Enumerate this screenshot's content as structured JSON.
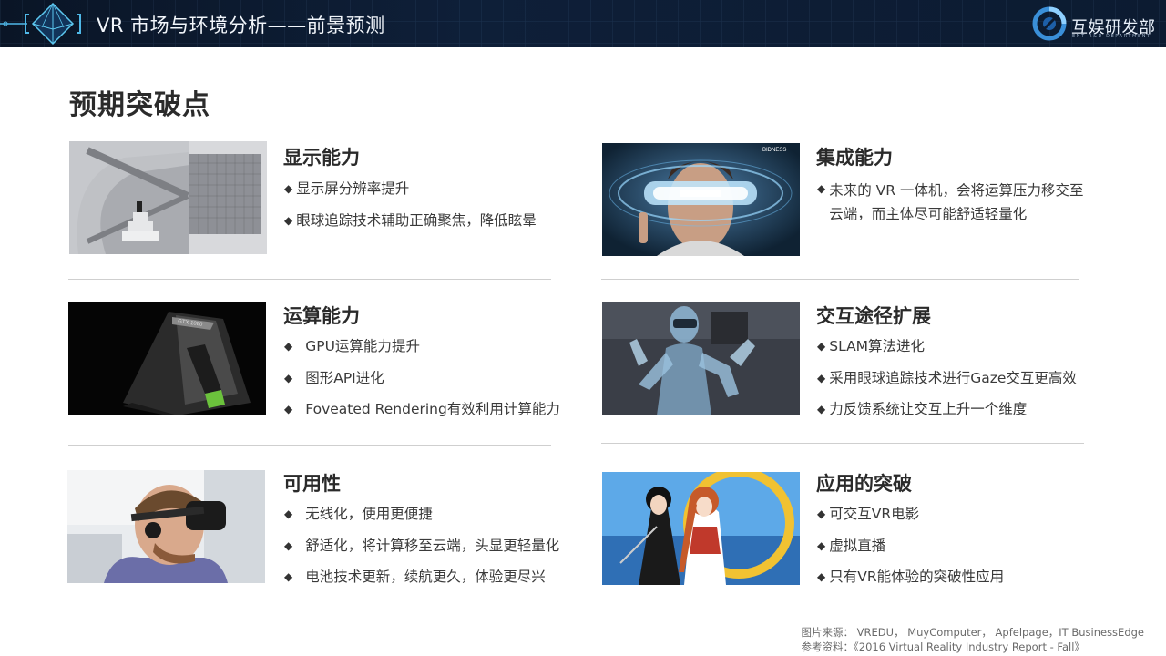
{
  "header": {
    "title": "VR 市场与环境分析——前景预测",
    "brand_name": "互娱研发部",
    "brand_sub": "ENT R&D DEPARTMENT"
  },
  "page_title": "预期突破点",
  "sections": [
    {
      "heading": "显示能力",
      "bullets": [
        "显示屏分辨率提升",
        "眼球追踪技术辅助正确聚焦，降低眩晕"
      ]
    },
    {
      "heading": "集成能力",
      "bullets": [
        "未来的 VR 一体机，会将运算压力移交至云端，而主体尽可能舒适轻量化"
      ],
      "image_watermark": "BIDNESS"
    },
    {
      "heading": "运算能力",
      "bullets": [
        "GPU运算能力提升",
        "图形API进化",
        "Foveated Rendering有效利用计算能力"
      ],
      "image_label": "GTX 1080"
    },
    {
      "heading": "交互途径扩展",
      "bullets": [
        "SLAM算法进化",
        "采用眼球追踪技术进行Gaze交互更高效",
        "力反馈系统让交互上升一个维度"
      ]
    },
    {
      "heading": "可用性",
      "bullets": [
        "无线化，使用更便捷",
        "舒适化，将计算移至云端，头显更轻量化",
        "电池技术更新，续航更久，体验更尽兴"
      ]
    },
    {
      "heading": "应用的突破",
      "bullets": [
        "可交互VR电影",
        "虚拟直播",
        "只有VR能体验的突破性应用"
      ]
    }
  ],
  "source": {
    "line1": "图片来源：  VREDU，  MuyComputer，  Apfelpage，IT BusinessEdge",
    "line2": "参考资料：《2016 Virtual Reality Industry Report - Fall》"
  },
  "colors": {
    "header_bg": "#0c1b31",
    "accent": "#3aa0e6"
  }
}
